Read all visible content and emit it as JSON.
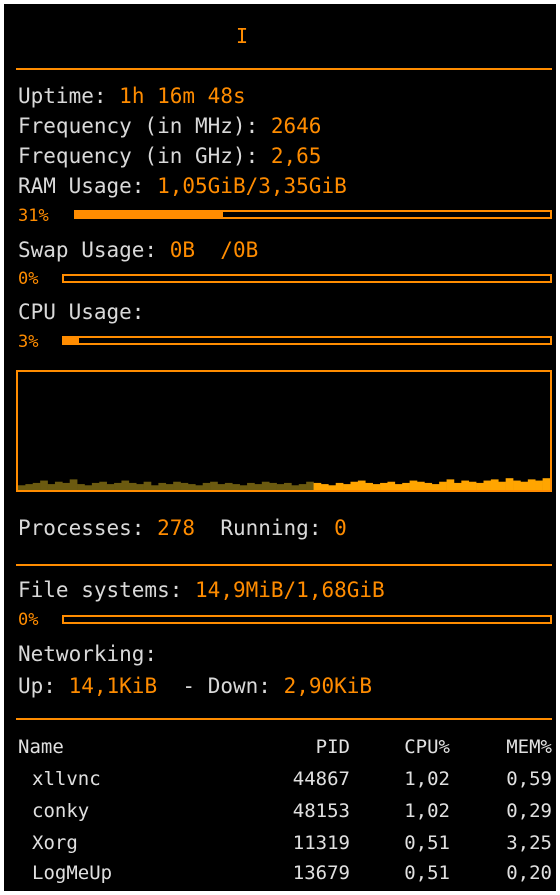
{
  "title": "I",
  "system": {
    "uptime_label": "Uptime:",
    "uptime_value": "1h 16m 48s",
    "freq_mhz_label": "Frequency (in MHz):",
    "freq_mhz_value": "2646",
    "freq_ghz_label": "Frequency (in GHz):",
    "freq_ghz_value": "2,65",
    "ram_label": "RAM Usage:",
    "ram_value": "1,05GiB/3,35GiB",
    "ram_percent": "31%",
    "ram_fraction": 0.31,
    "swap_label": "Swap Usage:",
    "swap_value": "0B  /0B",
    "swap_percent": "0%",
    "swap_fraction": 0.0,
    "cpu_label": "CPU Usage:",
    "cpu_percent": "3%",
    "cpu_fraction": 0.03
  },
  "cpu_graph": {
    "color_low": "#6b5a10",
    "color_high": "#ffa500",
    "samples": [
      0.04,
      0.05,
      0.06,
      0.08,
      0.05,
      0.07,
      0.06,
      0.09,
      0.05,
      0.04,
      0.06,
      0.07,
      0.05,
      0.06,
      0.08,
      0.06,
      0.05,
      0.07,
      0.04,
      0.06,
      0.05,
      0.07,
      0.06,
      0.05,
      0.04,
      0.06,
      0.07,
      0.05,
      0.06,
      0.05,
      0.04,
      0.06,
      0.05,
      0.07,
      0.06,
      0.05,
      0.06,
      0.04,
      0.05,
      0.07,
      0.06,
      0.05,
      0.04,
      0.06,
      0.05,
      0.07,
      0.08,
      0.06,
      0.05,
      0.06,
      0.07,
      0.05,
      0.06,
      0.08,
      0.07,
      0.06,
      0.05,
      0.07,
      0.09,
      0.06,
      0.08,
      0.07,
      0.06,
      0.08,
      0.09,
      0.07,
      0.1,
      0.08,
      0.07,
      0.09,
      0.08,
      0.1
    ]
  },
  "processes": {
    "label": "Processes:",
    "count": "278",
    "running_label": "Running:",
    "running_count": "0"
  },
  "filesystems": {
    "label": "File systems:",
    "value": "14,9MiB/1,68GiB",
    "percent": "0%",
    "fraction": 0.0
  },
  "network": {
    "label": "Networking:",
    "up_label": "Up:",
    "up_value": "14,1KiB",
    "down_label": "- Down:",
    "down_value": "2,90KiB"
  },
  "table": {
    "headers": [
      "Name",
      "PID",
      "CPU%",
      "MEM%"
    ],
    "rows": [
      {
        "name": "xllvnc",
        "pid": "44867",
        "cpu": "1,02",
        "mem": "0,59"
      },
      {
        "name": "conky",
        "pid": "48153",
        "cpu": "1,02",
        "mem": "0,29"
      },
      {
        "name": "Xorg",
        "pid": "11319",
        "cpu": "0,51",
        "mem": "3,25"
      },
      {
        "name": "LogMeUp",
        "pid": "13679",
        "cpu": "0,51",
        "mem": "0,20"
      }
    ]
  }
}
